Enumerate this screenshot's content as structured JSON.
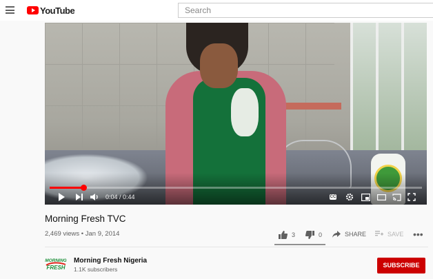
{
  "header": {
    "logo_text": "YouTube",
    "search_placeholder": "Search"
  },
  "player": {
    "time": "0:04 / 0:44",
    "progress_fraction": 0.09
  },
  "video": {
    "title": "Morning Fresh TVC",
    "meta": "2,469 views • Jan 9, 2014"
  },
  "actions": {
    "likes": "3",
    "dislikes": "0",
    "share_label": "SHARE",
    "save_label": "SAVE"
  },
  "channel": {
    "logo_text_1": "MORNING",
    "logo_text_2": "FRESH",
    "name": "Morning Fresh Nigeria",
    "subscribers": "1.1K subscribers"
  },
  "subscribe_label": "SUBSCRIBE",
  "colors": {
    "brand_red": "#ff0000",
    "subscribe_red": "#cc0000"
  },
  "icons": [
    "menu-icon",
    "youtube-logo-icon",
    "play-icon",
    "next-icon",
    "volume-icon",
    "captions-icon",
    "gear-icon",
    "miniplayer-icon",
    "theater-icon",
    "cast-icon",
    "fullscreen-icon",
    "thumbs-up-icon",
    "thumbs-down-icon",
    "share-icon",
    "save-playlist-icon",
    "more-icon"
  ]
}
